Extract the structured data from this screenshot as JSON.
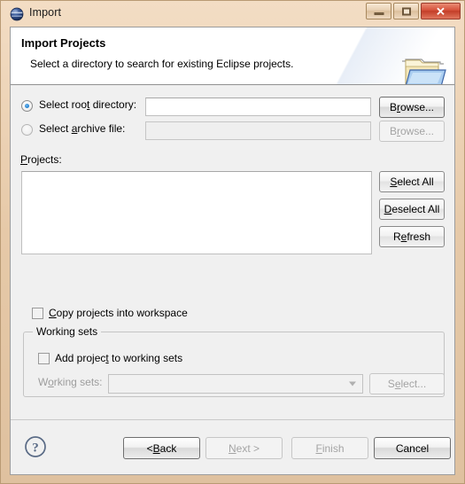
{
  "window": {
    "title": "Import",
    "icon": "eclipse-globe-icon",
    "controls": [
      {
        "name": "minimize-button",
        "glyph": "minimize"
      },
      {
        "name": "restore-button",
        "glyph": "restore"
      },
      {
        "name": "close-button",
        "glyph": "✕"
      }
    ]
  },
  "header": {
    "title": "Import Projects",
    "description": "Select a directory to search for existing Eclipse projects.",
    "icon": "open-folder-icon"
  },
  "source": {
    "root_directory": {
      "label_pre": "Select roo",
      "label_mnemonic": "t",
      "label_post": " directory:",
      "selected": true,
      "value": "",
      "browse_label_pre": "B",
      "browse_label_mnemonic": "r",
      "browse_label_post": "owse...",
      "enabled": true
    },
    "archive_file": {
      "label_pre": "Select ",
      "label_mnemonic": "a",
      "label_post": "rchive file:",
      "selected": false,
      "value": "",
      "browse_label_pre": "B",
      "browse_label_mnemonic": "r",
      "browse_label_post": "owse...",
      "enabled": false
    }
  },
  "projects": {
    "label_mnemonic": "P",
    "label_post": "rojects:",
    "items": [],
    "buttons": [
      {
        "name": "select-all-button",
        "pre": "",
        "mnemonic": "S",
        "post": "elect All",
        "enabled": true
      },
      {
        "name": "deselect-all-button",
        "pre": "",
        "mnemonic": "D",
        "post": "eselect All",
        "enabled": true
      },
      {
        "name": "refresh-button",
        "pre": "R",
        "mnemonic": "e",
        "post": "fresh",
        "enabled": true
      }
    ]
  },
  "options": {
    "copy_projects": {
      "pre": "",
      "mnemonic": "C",
      "post": "opy projects into workspace",
      "checked": false
    }
  },
  "working_sets": {
    "legend": "Working sets",
    "add_project": {
      "pre": "Add projec",
      "mnemonic": "t",
      "post": " to working sets",
      "checked": false
    },
    "combo_label_pre": "W",
    "combo_label_mnemonic": "o",
    "combo_label_post": "rking sets:",
    "combo_value": "",
    "select_button": {
      "pre": "S",
      "mnemonic": "e",
      "post": "lect...",
      "enabled": false
    },
    "enabled": false
  },
  "footer": {
    "help_icon": "help-question-icon",
    "buttons": [
      {
        "name": "back-button",
        "pre": "< ",
        "mnemonic": "B",
        "post": "ack",
        "enabled": true,
        "primary": true
      },
      {
        "name": "next-button",
        "pre": "",
        "mnemonic": "N",
        "post": "ext >",
        "enabled": false
      },
      {
        "name": "finish-button",
        "pre": "",
        "mnemonic": "F",
        "post": "inish",
        "enabled": false
      },
      {
        "name": "cancel-button",
        "pre": "",
        "mnemonic": "",
        "post": "Cancel",
        "enabled": true,
        "primary": true
      }
    ]
  },
  "colors": {
    "titlebar": "#e6c9a8",
    "accent_blue": "#1f7fcf",
    "close_red": "#c33e28",
    "dialog_bg": "#f0f0f0"
  }
}
